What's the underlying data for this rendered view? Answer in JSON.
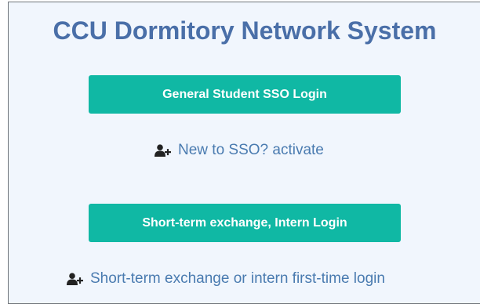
{
  "title": "CCU Dormitory Network System",
  "buttons": {
    "sso_login": "General Student SSO Login",
    "short_term_login": "Short-term exchange, Intern Login"
  },
  "links": {
    "activate_sso": "New to SSO? activate",
    "short_term_first_login": "Short-term exchange or intern first-time login"
  },
  "icons": {
    "activate_sso": "user-plus-icon",
    "short_term_first_login": "user-plus-icon"
  },
  "colors": {
    "title": "#4a6fa8",
    "button": "#10b8a4",
    "link": "#4a7bb0",
    "panel_bg": "#f1f6fd"
  }
}
